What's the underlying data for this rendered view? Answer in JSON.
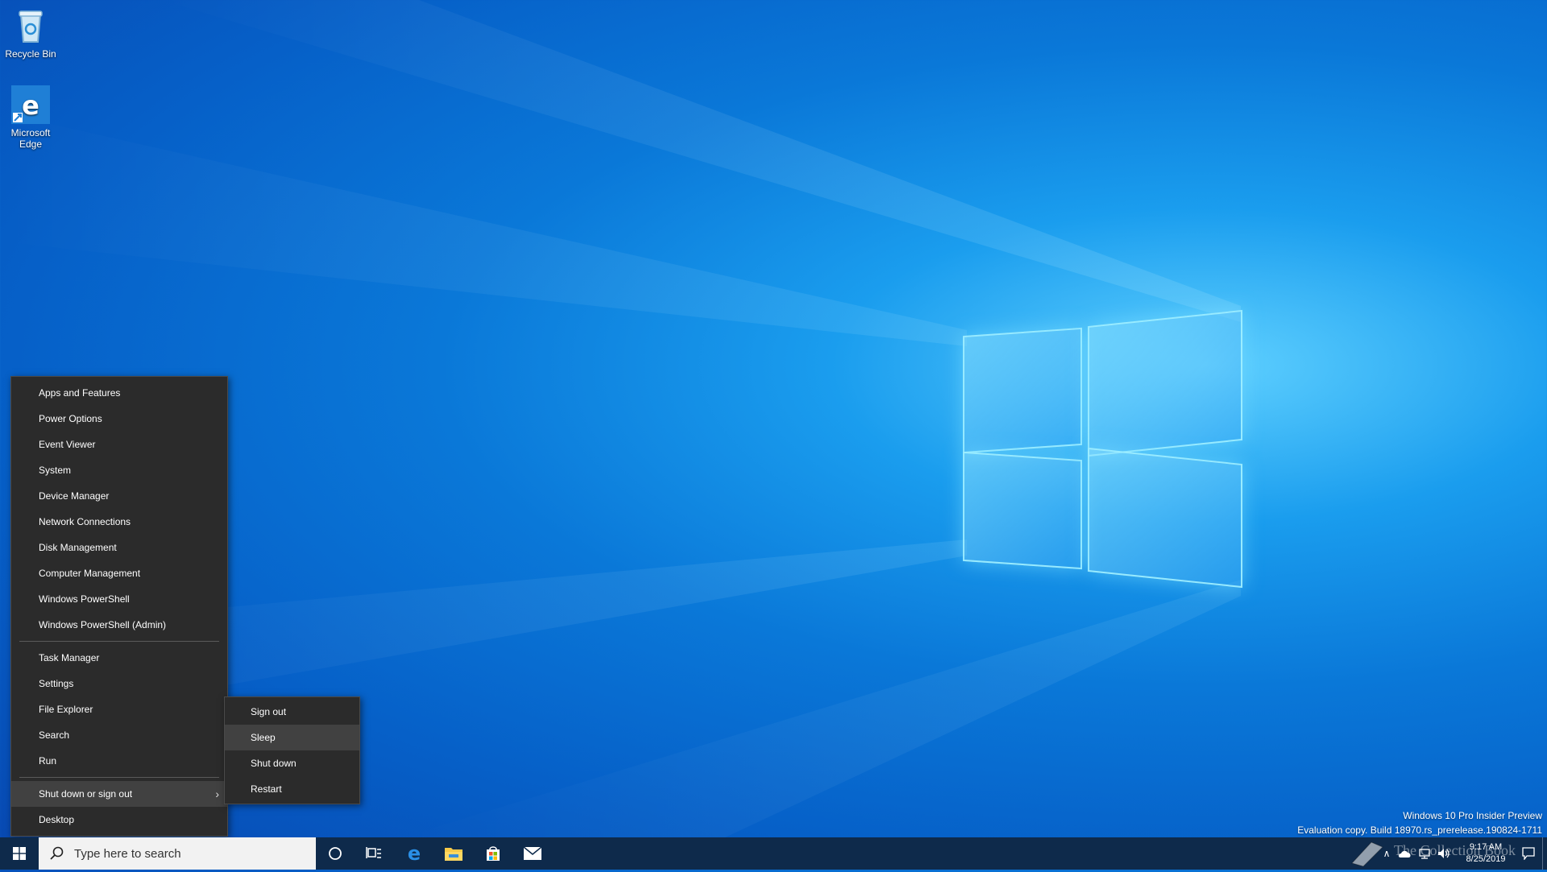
{
  "desktop": {
    "icons": [
      {
        "label": "Recycle Bin"
      },
      {
        "label": "Microsoft Edge"
      }
    ],
    "watermark": {
      "line1": "Windows 10 Pro Insider Preview",
      "line2": "Evaluation copy. Build 18970.rs_prerelease.190824-1711"
    },
    "overlay_text": "The Collection Book"
  },
  "winx_menu": {
    "group1": [
      "Apps and Features",
      "Power Options",
      "Event Viewer",
      "System",
      "Device Manager",
      "Network Connections",
      "Disk Management",
      "Computer Management",
      "Windows PowerShell",
      "Windows PowerShell (Admin)"
    ],
    "group2": [
      "Task Manager",
      "Settings",
      "File Explorer",
      "Search",
      "Run"
    ],
    "shutdown_item": "Shut down or sign out",
    "desktop_item": "Desktop"
  },
  "submenu": {
    "items": [
      "Sign out",
      "Sleep",
      "Shut down",
      "Restart"
    ],
    "highlighted": "Sleep"
  },
  "taskbar": {
    "search_placeholder": "Type here to search",
    "pinned": [
      "cortana-icon",
      "task-view-icon",
      "edge-icon",
      "file-explorer-icon",
      "store-icon",
      "mail-icon"
    ],
    "clock_time": "9:17 AM",
    "clock_date": "8/25/2019"
  },
  "colors": {
    "menu_bg": "#2b2b2b",
    "menu_highlight": "#414141",
    "taskbar_bg": "#0e2a4b",
    "accent": "#0078d7"
  }
}
